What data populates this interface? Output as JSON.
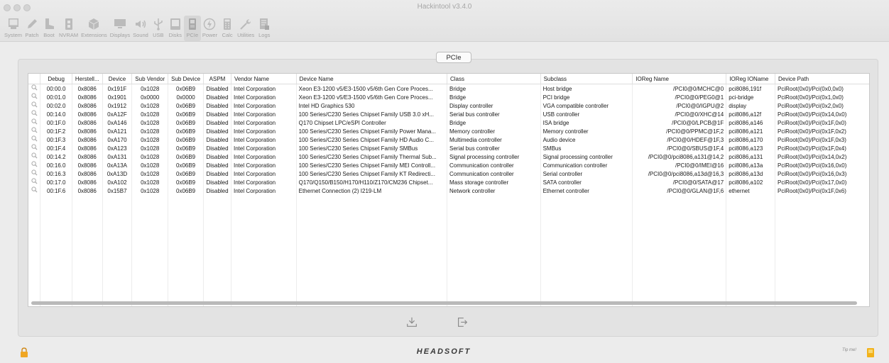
{
  "window": {
    "title": "Hackintool v3.4.0"
  },
  "toolbar": {
    "items": [
      {
        "label": "System",
        "icon": "monitor-icon"
      },
      {
        "label": "Patch",
        "icon": "pencil-icon"
      },
      {
        "label": "Boot",
        "icon": "boot-icon"
      },
      {
        "label": "NVRAM",
        "icon": "memory-chip-icon"
      },
      {
        "label": "Extensions",
        "icon": "cube-icon"
      },
      {
        "label": "Displays",
        "icon": "display-icon"
      },
      {
        "label": "Sound",
        "icon": "speaker-icon"
      },
      {
        "label": "USB",
        "icon": "usb-icon"
      },
      {
        "label": "Disks",
        "icon": "disk-icon"
      },
      {
        "label": "PCIe",
        "icon": "pcie-card-icon"
      },
      {
        "label": "Power",
        "icon": "power-bolt-icon"
      },
      {
        "label": "Calc",
        "icon": "calculator-icon"
      },
      {
        "label": "Utilities",
        "icon": "wrench-icon"
      },
      {
        "label": "Logs",
        "icon": "log-document-icon"
      }
    ],
    "active": "PCIe"
  },
  "panel": {
    "tab_label": "PCIe"
  },
  "table": {
    "columns": [
      "",
      "Debug",
      "Herstell...",
      "Device",
      "Sub Vendor",
      "Sub Device",
      "ASPM",
      "Vendor Name",
      "Device Name",
      "Class",
      "Subclass",
      "IOReg Name",
      "IOReg IOName",
      "Device Path"
    ],
    "rows": [
      [
        "00:00.0",
        "0x8086",
        "0x191F",
        "0x1028",
        "0x06B9",
        "Disabled",
        "Intel Corporation",
        "Xeon E3-1200 v5/E3-1500 v5/6th Gen Core Proces...",
        "Bridge",
        "Host bridge",
        "/PCI0@0/MCHC@0",
        "pci8086,191f",
        "PciRoot(0x0)/Pci(0x0,0x0)"
      ],
      [
        "00:01.0",
        "0x8086",
        "0x1901",
        "0x0000",
        "0x0000",
        "Disabled",
        "Intel Corporation",
        "Xeon E3-1200 v5/E3-1500 v5/6th Gen Core Proces...",
        "Bridge",
        "PCI bridge",
        "/PCI0@0/PEG0@1",
        "pci-bridge",
        "PciRoot(0x0)/Pci(0x1,0x0)"
      ],
      [
        "00:02.0",
        "0x8086",
        "0x1912",
        "0x1028",
        "0x06B9",
        "Disabled",
        "Intel Corporation",
        "Intel HD Graphics 530",
        "Display controller",
        "VGA compatible controller",
        "/PCI0@0/IGPU@2",
        "display",
        "PciRoot(0x0)/Pci(0x2,0x0)"
      ],
      [
        "00:14.0",
        "0x8086",
        "0xA12F",
        "0x1028",
        "0x06B9",
        "Disabled",
        "Intel Corporation",
        "100 Series/C230 Series Chipset Family USB 3.0 xH...",
        "Serial bus controller",
        "USB controller",
        "/PCI0@0/XHC@14",
        "pci8086,a12f",
        "PciRoot(0x0)/Pci(0x14,0x0)"
      ],
      [
        "00:1F.0",
        "0x8086",
        "0xA146",
        "0x1028",
        "0x06B9",
        "Disabled",
        "Intel Corporation",
        "Q170 Chipset LPC/eSPI Controller",
        "Bridge",
        "ISA bridge",
        "/PCI0@0/LPCB@1F",
        "pci8086,a146",
        "PciRoot(0x0)/Pci(0x1F,0x0)"
      ],
      [
        "00:1F.2",
        "0x8086",
        "0xA121",
        "0x1028",
        "0x06B9",
        "Disabled",
        "Intel Corporation",
        "100 Series/C230 Series Chipset Family Power Mana...",
        "Memory controller",
        "Memory controller",
        "/PCI0@0/PPMC@1F,2",
        "pci8086,a121",
        "PciRoot(0x0)/Pci(0x1F,0x2)"
      ],
      [
        "00:1F.3",
        "0x8086",
        "0xA170",
        "0x1028",
        "0x06B9",
        "Disabled",
        "Intel Corporation",
        "100 Series/C230 Series Chipset Family HD Audio C...",
        "Multimedia controller",
        "Audio device",
        "/PCI0@0/HDEF@1F,3",
        "pci8086,a170",
        "PciRoot(0x0)/Pci(0x1F,0x3)"
      ],
      [
        "00:1F.4",
        "0x8086",
        "0xA123",
        "0x1028",
        "0x06B9",
        "Disabled",
        "Intel Corporation",
        "100 Series/C230 Series Chipset Family SMBus",
        "Serial bus controller",
        "SMBus",
        "/PCI0@0/SBUS@1F,4",
        "pci8086,a123",
        "PciRoot(0x0)/Pci(0x1F,0x4)"
      ],
      [
        "00:14.2",
        "0x8086",
        "0xA131",
        "0x1028",
        "0x06B9",
        "Disabled",
        "Intel Corporation",
        "100 Series/C230 Series Chipset Family Thermal Sub...",
        "Signal processing controller",
        "Signal processing controller",
        "/PCI0@0/pci8086,a131@14,2",
        "pci8086,a131",
        "PciRoot(0x0)/Pci(0x14,0x2)"
      ],
      [
        "00:16.0",
        "0x8086",
        "0xA13A",
        "0x1028",
        "0x06B9",
        "Disabled",
        "Intel Corporation",
        "100 Series/C230 Series Chipset Family MEI Controll...",
        "Communication controller",
        "Communication controller",
        "/PCI0@0/IMEI@16",
        "pci8086,a13a",
        "PciRoot(0x0)/Pci(0x16,0x0)"
      ],
      [
        "00:16.3",
        "0x8086",
        "0xA13D",
        "0x1028",
        "0x06B9",
        "Disabled",
        "Intel Corporation",
        "100 Series/C230 Series Chipset Family KT Redirecti...",
        "Communication controller",
        "Serial controller",
        "/PCI0@0/pci8086,a13d@16,3",
        "pci8086,a13d",
        "PciRoot(0x0)/Pci(0x16,0x3)"
      ],
      [
        "00:17.0",
        "0x8086",
        "0xA102",
        "0x1028",
        "0x06B9",
        "Disabled",
        "Intel Corporation",
        "Q170/Q150/B150/H170/H110/Z170/CM236 Chipset...",
        "Mass storage controller",
        "SATA controller",
        "/PCI0@0/SATA@17",
        "pci8086,a102",
        "PciRoot(0x0)/Pci(0x17,0x0)"
      ],
      [
        "00:1F.6",
        "0x8086",
        "0x15B7",
        "0x1028",
        "0x06B9",
        "Disabled",
        "Intel Corporation",
        "Ethernet Connection (2) I219-LM",
        "Network controller",
        "Ethernet controller",
        "/PCI0@0/GLAN@1F,6",
        "ethernet",
        "PciRoot(0x0)/Pci(0x1F,0x6)"
      ]
    ]
  },
  "actions": {
    "export_icon": "export-download-icon",
    "open_icon": "open-arrow-icon"
  },
  "footer": {
    "brand": "HEADSOFT",
    "tip_label": "Tip me!",
    "lock_icon": "lock-icon"
  }
}
